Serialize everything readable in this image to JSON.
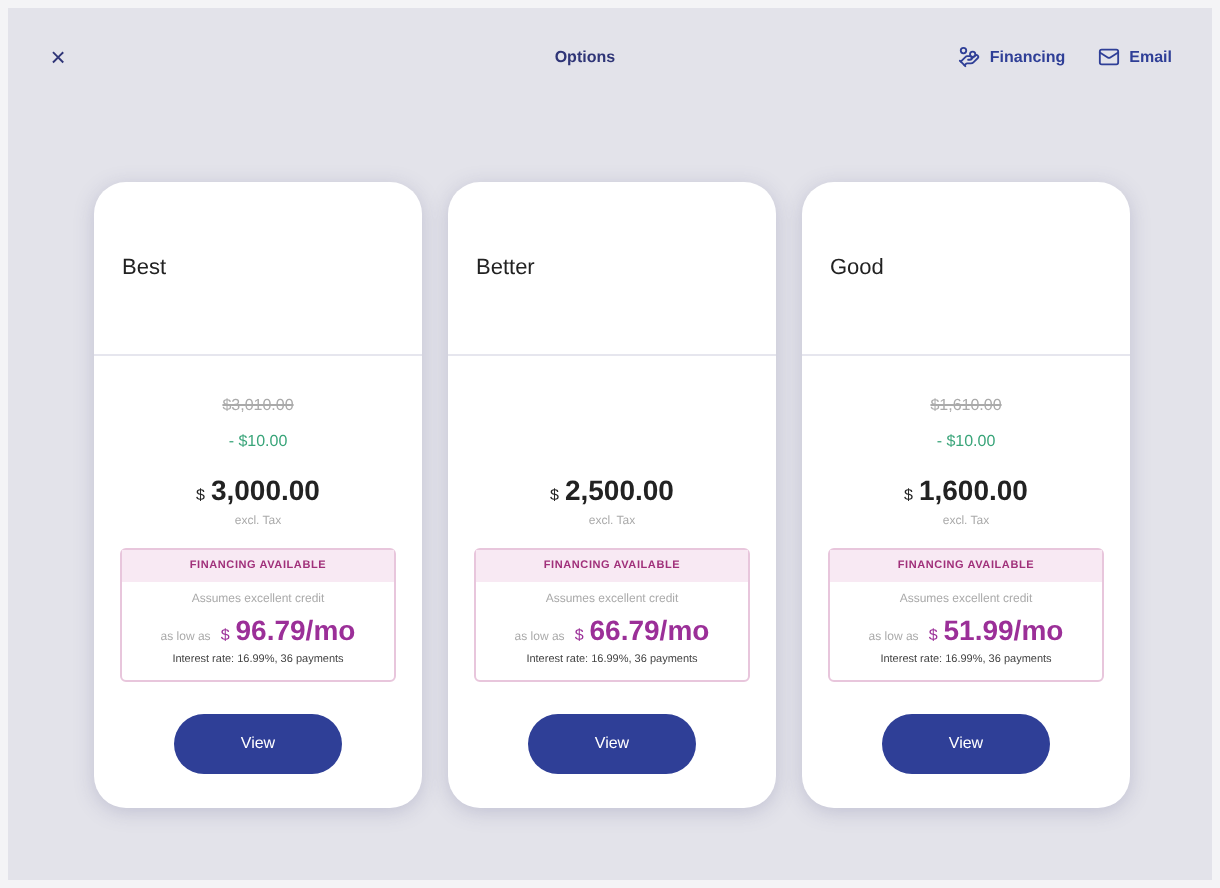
{
  "header": {
    "close": "×",
    "title": "Options",
    "actions": [
      {
        "label": "Financing",
        "kind": "financing"
      },
      {
        "label": "Email",
        "kind": "email"
      }
    ]
  },
  "options": [
    {
      "name": "Best",
      "original_price": "$3,010.00",
      "discount": "- $10.00",
      "currency": "$",
      "price": "3,000.00",
      "tax_note": "excl. Tax",
      "financing": {
        "heading": "FINANCING AVAILABLE",
        "note": "Assumes excellent credit",
        "prefix": "as low as",
        "currency": "$",
        "monthly": "96.79/mo",
        "terms": "Interest rate: 16.99%, 36 payments"
      },
      "button": "View"
    },
    {
      "name": "Better",
      "currency": "$",
      "price": "2,500.00",
      "tax_note": "excl. Tax",
      "financing": {
        "heading": "FINANCING AVAILABLE",
        "note": "Assumes excellent credit",
        "prefix": "as low as",
        "currency": "$",
        "monthly": "66.79/mo",
        "terms": "Interest rate: 16.99%, 36 payments"
      },
      "button": "View"
    },
    {
      "name": "Good",
      "original_price": "$1,610.00",
      "discount": "- $10.00",
      "currency": "$",
      "price": "1,600.00",
      "tax_note": "excl. Tax",
      "financing": {
        "heading": "FINANCING AVAILABLE",
        "note": "Assumes excellent credit",
        "prefix": "as low as",
        "currency": "$",
        "monthly": "51.99/mo",
        "terms": "Interest rate: 16.99%, 36 payments"
      },
      "button": "View"
    }
  ]
}
